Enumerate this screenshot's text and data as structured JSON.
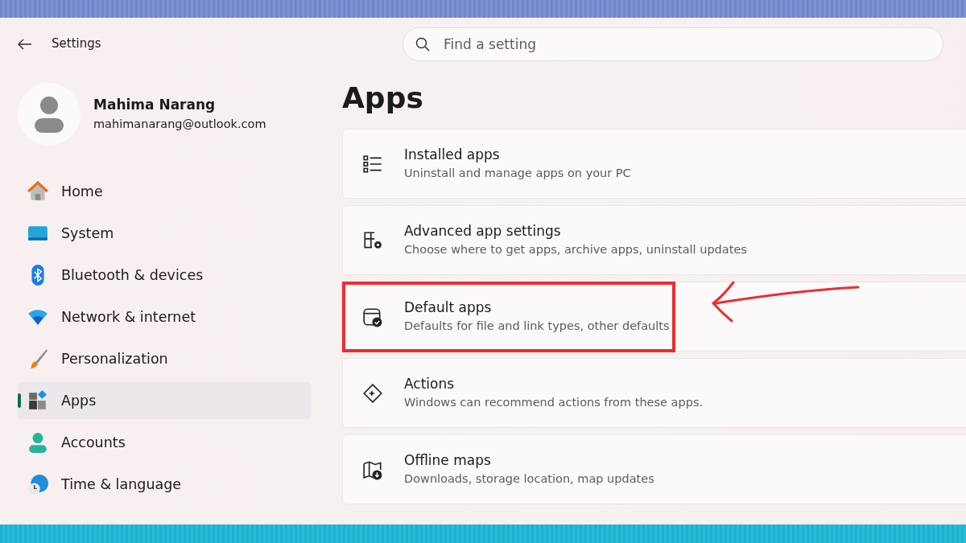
{
  "window": {
    "title": "Settings"
  },
  "search": {
    "placeholder": "Find a setting"
  },
  "profile": {
    "name": "Mahima Narang",
    "email": "mahimanarang@outlook.com"
  },
  "sidebar": {
    "items": [
      {
        "kind": "home",
        "label": "Home",
        "selected": false
      },
      {
        "kind": "system",
        "label": "System",
        "selected": false
      },
      {
        "kind": "bluetooth",
        "label": "Bluetooth & devices",
        "selected": false
      },
      {
        "kind": "network",
        "label": "Network & internet",
        "selected": false
      },
      {
        "kind": "personalization",
        "label": "Personalization",
        "selected": false
      },
      {
        "kind": "apps",
        "label": "Apps",
        "selected": true
      },
      {
        "kind": "accounts",
        "label": "Accounts",
        "selected": false
      },
      {
        "kind": "time",
        "label": "Time & language",
        "selected": false
      }
    ]
  },
  "page": {
    "title": "Apps"
  },
  "cards": [
    {
      "kind": "list",
      "title": "Installed apps",
      "subtitle": "Uninstall and manage apps on your PC",
      "highlighted": false
    },
    {
      "kind": "advanced",
      "title": "Advanced app settings",
      "subtitle": "Choose where to get apps, archive apps, uninstall updates",
      "highlighted": false
    },
    {
      "kind": "default",
      "title": "Default apps",
      "subtitle": "Defaults for file and link types, other defaults",
      "highlighted": true
    },
    {
      "kind": "actions",
      "title": "Actions",
      "subtitle": "Windows can recommend actions from these apps.",
      "highlighted": false
    },
    {
      "kind": "map",
      "title": "Offline maps",
      "subtitle": "Downloads, storage location, map updates",
      "highlighted": false
    }
  ]
}
